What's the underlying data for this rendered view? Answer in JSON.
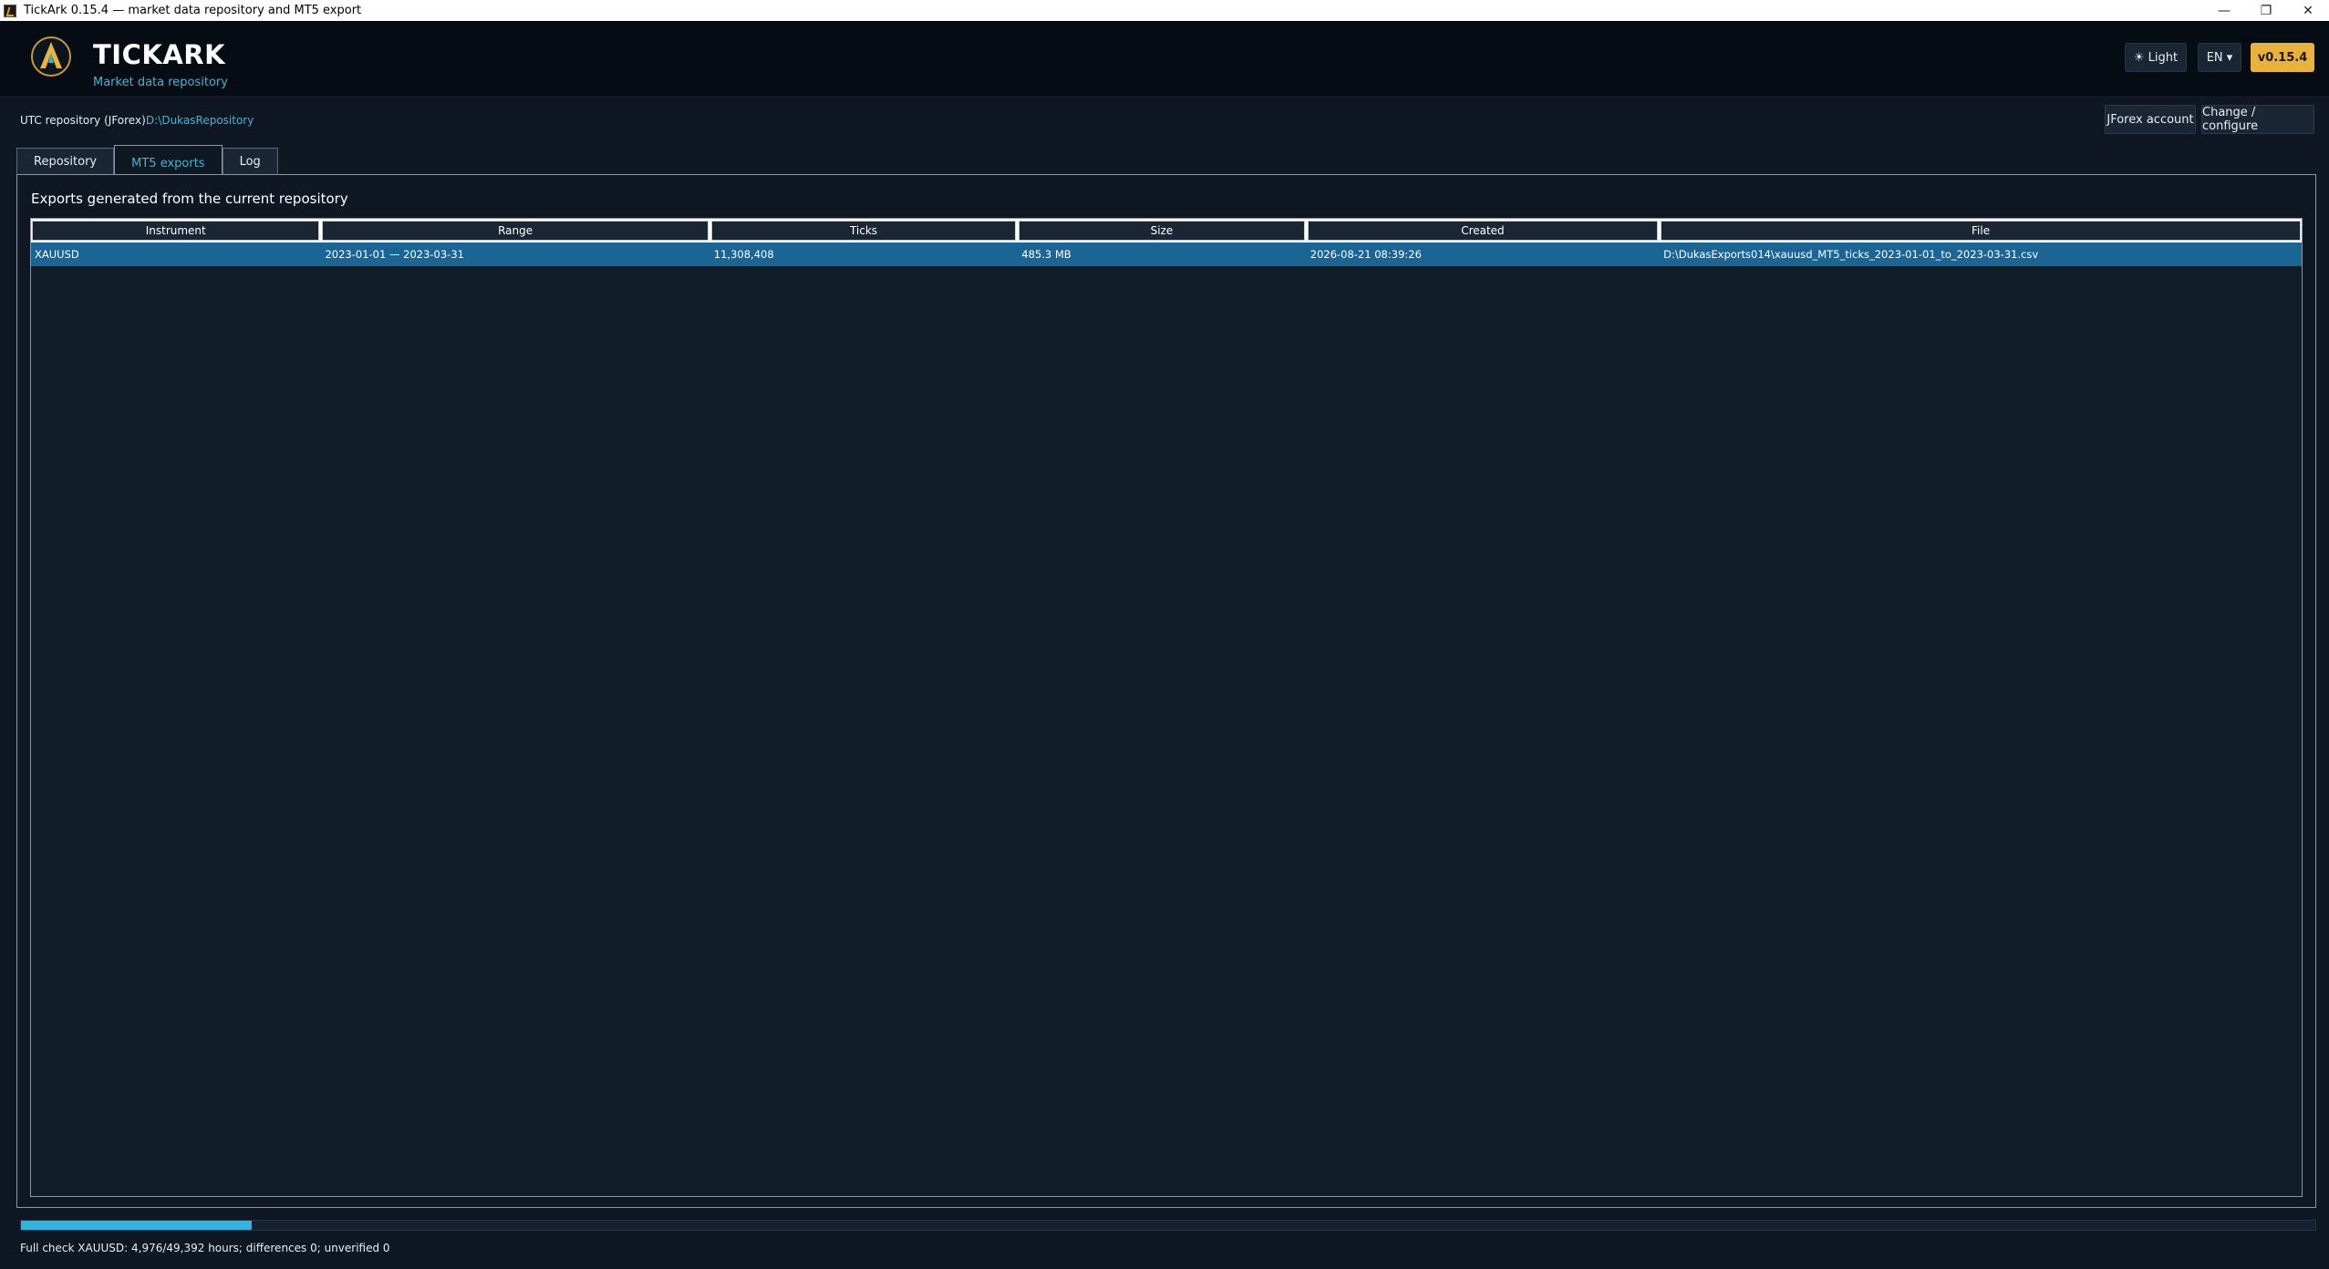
{
  "window": {
    "title": "TickArk 0.15.4 — market data repository and MT5 export",
    "controls": [
      "—",
      "❐",
      "✕"
    ]
  },
  "header": {
    "brand": "TICKARK",
    "subtitle": "Market data repository",
    "theme_button": "☀ Light",
    "lang_button": "EN ▾",
    "version_button": "v0.15.4",
    "accent": "#e9b23a"
  },
  "repository": {
    "label": "UTC repository (JForex):",
    "path": "D:\\DukasRepository",
    "jforex_button": "JForex account",
    "change_button": "Change / configure"
  },
  "tabs": [
    {
      "label": "Repository",
      "active": false
    },
    {
      "label": "MT5 exports",
      "active": true
    },
    {
      "label": "Log",
      "active": false
    }
  ],
  "exports": {
    "title": "Exports generated from the current repository",
    "columns": [
      "Instrument",
      "Range",
      "Ticks",
      "Size",
      "Created",
      "File"
    ],
    "rows": [
      {
        "instrument": "XAUUSD",
        "range": "2023-01-01 — 2023-03-31",
        "ticks": "11,308,408",
        "size": "485.3 MB",
        "created": "2026-08-21 08:39:26",
        "file": "D:\\DukasExports014\\xauusd_MT5_ticks_2023-01-01_to_2023-03-31.csv"
      }
    ]
  },
  "status": {
    "progress_fraction": 0.1007,
    "text": "Full check XAUUSD: 4,976/49,392 hours; differences 0; unverified 0"
  }
}
